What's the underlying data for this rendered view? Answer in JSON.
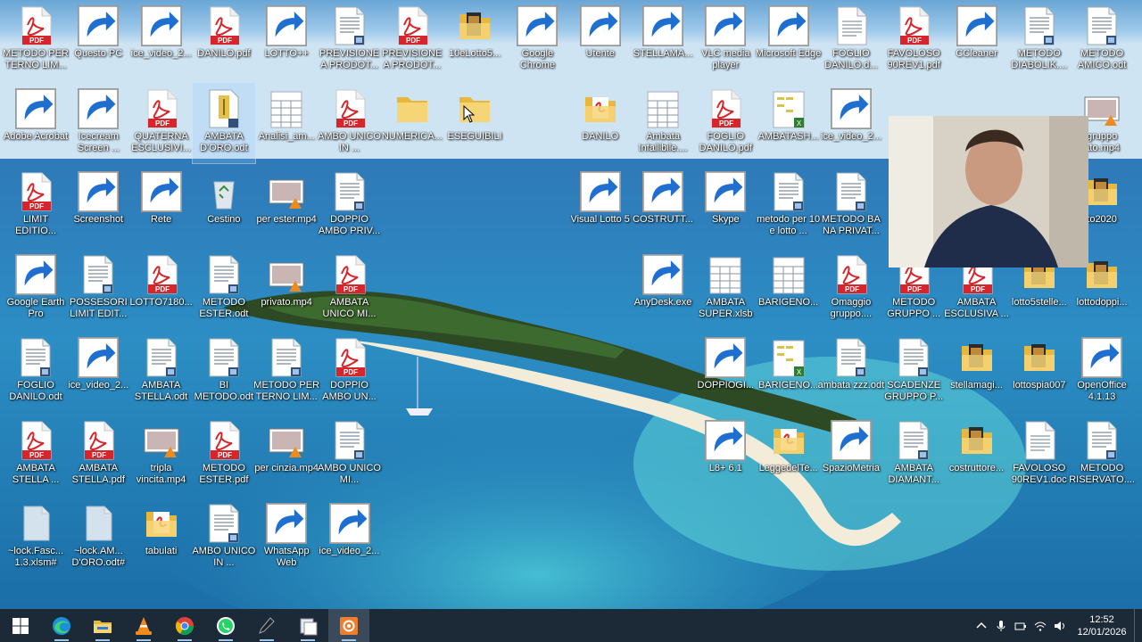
{
  "desktop": {
    "selected_index": 21,
    "icons": [
      {
        "label": "METODO PER TERNO LIM...",
        "type": "pdf"
      },
      {
        "label": "Questo PC",
        "type": "pc"
      },
      {
        "label": "ice_video_2...",
        "type": "vlc"
      },
      {
        "label": "DANILO.pdf",
        "type": "pdf"
      },
      {
        "label": "LOTTO++",
        "type": "lotto"
      },
      {
        "label": "PREVISIONE A PRODOT...",
        "type": "odt"
      },
      {
        "label": "PREVISIONE A PRODOT...",
        "type": "pdf"
      },
      {
        "label": "10eLotto5...",
        "type": "folderimg"
      },
      {
        "label": "Google Chrome",
        "type": "chrome"
      },
      {
        "label": "Utente",
        "type": "user"
      },
      {
        "label": "STELLAMA...",
        "type": "star"
      },
      {
        "label": "VLC media player",
        "type": "vlc"
      },
      {
        "label": "Microsoft Edge",
        "type": "edge"
      },
      {
        "label": "FOGLIO DANILO.d...",
        "type": "doc"
      },
      {
        "label": "FAVOLOSO 90REV1.pdf",
        "type": "pdf"
      },
      {
        "label": "CCleaner",
        "type": "ccleaner"
      },
      {
        "label": "METODO DIABOLIK....",
        "type": "odt"
      },
      {
        "label": "METODO AMICO.odt",
        "type": "odt"
      },
      {
        "label": "Adobe Acrobat",
        "type": "acrobat"
      },
      {
        "label": "Icecream Screen ...",
        "type": "icecream"
      },
      {
        "label": "QUATERNA ESCLUSIVI...",
        "type": "pdf"
      },
      {
        "label": "AMBATA D'ORO.odt",
        "type": "odtgold"
      },
      {
        "label": "Analisi_am...",
        "type": "sheet"
      },
      {
        "label": "AMBO UNICO IN ...",
        "type": "pdf"
      },
      {
        "label": "NUMERICA...",
        "type": "folder"
      },
      {
        "label": "ESEGUIBILI",
        "type": "folder"
      },
      {
        "label": "DANILO",
        "type": "folderpdf"
      },
      {
        "label": "Ambata Infallibile....",
        "type": "sheet"
      },
      {
        "label": "FOGLIO DANILO.pdf",
        "type": "pdf"
      },
      {
        "label": "AMBATASH...",
        "type": "xls"
      },
      {
        "label": "ice_video_2...",
        "type": "vlc"
      },
      {
        "label": "gruppo ato.mp4",
        "type": "video"
      },
      {
        "label": "LIMIT EDITIO...",
        "type": "pdf"
      },
      {
        "label": "Screenshot",
        "type": "icecream"
      },
      {
        "label": "Rete",
        "type": "network"
      },
      {
        "label": "Cestino",
        "type": "recycle"
      },
      {
        "label": "per ester.mp4",
        "type": "video"
      },
      {
        "label": "DOPPIO AMBO PRIV...",
        "type": "odt"
      },
      {
        "label": "Visual Lotto 5",
        "type": "visual"
      },
      {
        "label": "COSTRUTT...",
        "type": "cube"
      },
      {
        "label": "Skype",
        "type": "skype"
      },
      {
        "label": "metodo per 10 e lotto ...",
        "type": "odt"
      },
      {
        "label": "METODO BA NA PRIVAT...",
        "type": "odt"
      },
      {
        "label": "to2020",
        "type": "folderimg"
      },
      {
        "label": "Google Earth Pro",
        "type": "earth"
      },
      {
        "label": "POSSESORI LIMIT EDIT...",
        "type": "odt"
      },
      {
        "label": "LOTTO7180...",
        "type": "pdf"
      },
      {
        "label": "METODO ESTER.odt",
        "type": "odt"
      },
      {
        "label": "privato.mp4",
        "type": "video"
      },
      {
        "label": "AMBATA UNICO MI...",
        "type": "pdf"
      },
      {
        "label": "AnyDesk.exe",
        "type": "anydesk"
      },
      {
        "label": "AMBATA SUPER.xlsb",
        "type": "sheet"
      },
      {
        "label": "BARIGENO...",
        "type": "sheet"
      },
      {
        "label": "Omaggio gruppo....",
        "type": "pdf"
      },
      {
        "label": "METODO GRUPPO ...",
        "type": "pdf"
      },
      {
        "label": "AMBATA ESCLUSIVA ...",
        "type": "pdf"
      },
      {
        "label": "lotto5stelle...",
        "type": "folderimg"
      },
      {
        "label": "lottodoppi...",
        "type": "folderimg"
      },
      {
        "label": "FOGLIO DANILO.odt",
        "type": "odt"
      },
      {
        "label": "ice_video_2...",
        "type": "vlc"
      },
      {
        "label": "AMBATA STELLA.odt",
        "type": "odt"
      },
      {
        "label": "BI METODO.odt",
        "type": "odt"
      },
      {
        "label": "METODO PER TERNO LIM...",
        "type": "odt"
      },
      {
        "label": "DOPPIO AMBO UN...",
        "type": "pdf"
      },
      {
        "label": "DOPPIOGI...",
        "type": "star"
      },
      {
        "label": "BARIGENO...",
        "type": "xls"
      },
      {
        "label": "ambata zzz.odt",
        "type": "odt"
      },
      {
        "label": "SCADENZE GRUPPO P...",
        "type": "odt"
      },
      {
        "label": "stellamagi...",
        "type": "folderimg"
      },
      {
        "label": "lottospia007",
        "type": "folderimg"
      },
      {
        "label": "OpenOffice 4.1.13",
        "type": "openoffice"
      },
      {
        "label": "AMBATA STELLA ...",
        "type": "pdf"
      },
      {
        "label": "AMBATA STELLA.pdf",
        "type": "pdf"
      },
      {
        "label": "tripla vincita.mp4",
        "type": "video"
      },
      {
        "label": "METODO ESTER.pdf",
        "type": "pdf"
      },
      {
        "label": "per cinzia.mp4",
        "type": "video"
      },
      {
        "label": "AMBO UNICO MI...",
        "type": "odt"
      },
      {
        "label": "L8+ 6.1",
        "type": "l8"
      },
      {
        "label": "LeggedelTe...",
        "type": "folderpdf"
      },
      {
        "label": "SpazioMetria",
        "type": "spazio"
      },
      {
        "label": "AMBATA DIAMANT...",
        "type": "odt"
      },
      {
        "label": "costruttore...",
        "type": "folderimg"
      },
      {
        "label": "FAVOLOSO 90REV1.doc",
        "type": "doc"
      },
      {
        "label": "METODO RISERVATO....",
        "type": "odt"
      },
      {
        "label": "~lock.Fasc... 1.3.xlsm#",
        "type": "blank"
      },
      {
        "label": "~lock.AM... D'ORO.odt#",
        "type": "blank"
      },
      {
        "label": "tabulati",
        "type": "folderpdf"
      },
      {
        "label": "AMBO UNICO IN ...",
        "type": "odt"
      },
      {
        "label": "WhatsApp Web",
        "type": "whatsapp"
      },
      {
        "label": "ice_video_2...",
        "type": "vlc"
      }
    ]
  },
  "taskbar": {
    "apps": [
      {
        "name": "start-button",
        "icon": "windows"
      },
      {
        "name": "edge-taskbar",
        "icon": "edge"
      },
      {
        "name": "explorer-taskbar",
        "icon": "explorer"
      },
      {
        "name": "vlc-taskbar",
        "icon": "vlc"
      },
      {
        "name": "chrome-taskbar",
        "icon": "chrome"
      },
      {
        "name": "whatsapp-taskbar",
        "icon": "whatsapp"
      },
      {
        "name": "pen-taskbar",
        "icon": "pen"
      },
      {
        "name": "scanner-taskbar",
        "icon": "scanner"
      },
      {
        "name": "icecream-taskbar",
        "icon": "icecream"
      }
    ],
    "clock": {
      "time": "12:52",
      "date": "12/01/2026"
    }
  },
  "colors": {
    "taskbar": "#1c2a38",
    "pdf_red": "#d7262b",
    "folder": "#f0c95c",
    "label": "#ffffff"
  }
}
